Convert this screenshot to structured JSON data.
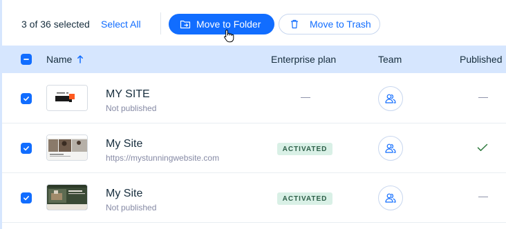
{
  "toolbar": {
    "selection_count": "3 of 36 selected",
    "select_all": "Select All",
    "move_to_folder": "Move to Folder",
    "move_to_trash": "Move to Trash"
  },
  "table": {
    "headers": {
      "name": "Name",
      "enterprise_plan": "Enterprise plan",
      "team": "Team",
      "published": "Published"
    },
    "sort": "ascending",
    "rows": [
      {
        "name": "MY SITE",
        "subtitle": "Not published",
        "enterprise_plan": "—",
        "published": "—",
        "selected": true
      },
      {
        "name": "My Site",
        "subtitle": "https://mystunningwebsite.com",
        "enterprise_plan": "ACTIVATED",
        "published": "check",
        "selected": true
      },
      {
        "name": "My Site",
        "subtitle": "Not published",
        "enterprise_plan": "ACTIVATED",
        "published": "—",
        "selected": true
      }
    ]
  },
  "colors": {
    "accent": "#116dff",
    "header_bg": "#d6e6fe",
    "badge_bg": "#d9f0e6",
    "published_check": "#2f7a3e"
  },
  "icons": [
    "folder-move-icon",
    "trash-icon",
    "sort-arrow-up-icon",
    "checkbox-checked-icon",
    "team-icon",
    "checkmark-icon",
    "hand-cursor-icon"
  ]
}
